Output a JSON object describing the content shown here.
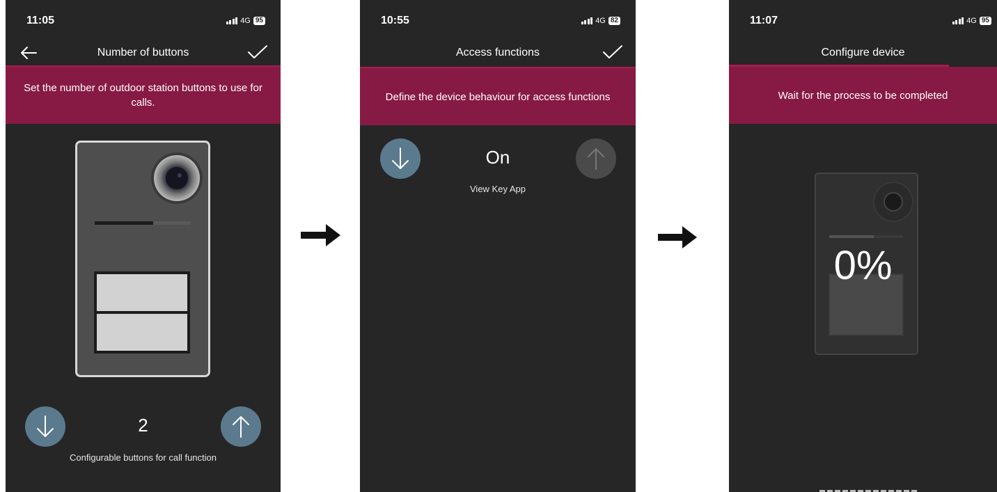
{
  "screen1": {
    "time": "11:05",
    "network": "4G",
    "battery": "95",
    "title": "Number of buttons",
    "banner": "Set the number of outdoor station buttons to use for calls.",
    "value": "2",
    "caption": "Configurable buttons for call function"
  },
  "screen2": {
    "time": "10:55",
    "network": "4G",
    "battery": "82",
    "title": "Access functions",
    "banner": "Define the device behaviour for access functions",
    "value": "On",
    "caption": "View Key App"
  },
  "screen3": {
    "time": "11:07",
    "network": "4G",
    "battery": "95",
    "title": "Configure device",
    "banner": "Wait for the process to be completed",
    "progress_text": "0%",
    "progress": 0
  },
  "colors": {
    "background": "#262626",
    "banner": "#871a44",
    "accent_line": "#a31e4c",
    "button_active": "#5b7a8e",
    "button_disabled": "#4a4a4a"
  },
  "icons": [
    "back-arrow-icon",
    "checkmark-icon",
    "arrow-down-icon",
    "arrow-up-icon",
    "flow-arrow-icon"
  ]
}
